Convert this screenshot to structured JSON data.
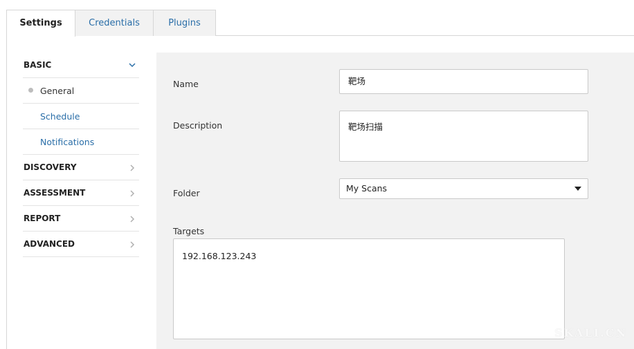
{
  "tabs": [
    {
      "label": "Settings",
      "active": true
    },
    {
      "label": "Credentials",
      "active": false
    },
    {
      "label": "Plugins",
      "active": false
    }
  ],
  "sidebar": {
    "items": [
      {
        "label": "BASIC",
        "type": "section",
        "icon": "chevron-down-icon",
        "expanded": true
      },
      {
        "label": "General",
        "type": "sub",
        "current": true
      },
      {
        "label": "Schedule",
        "type": "sub"
      },
      {
        "label": "Notifications",
        "type": "sub"
      },
      {
        "label": "DISCOVERY",
        "type": "section",
        "icon": "chevron-right-icon"
      },
      {
        "label": "ASSESSMENT",
        "type": "section",
        "icon": "chevron-right-icon"
      },
      {
        "label": "REPORT",
        "type": "section",
        "icon": "chevron-right-icon"
      },
      {
        "label": "ADVANCED",
        "type": "section",
        "icon": "chevron-right-icon"
      }
    ]
  },
  "form": {
    "name_label": "Name",
    "name_value": "靶场",
    "description_label": "Description",
    "description_value": "靶场扫描",
    "folder_label": "Folder",
    "folder_value": "My Scans",
    "targets_label": "Targets",
    "targets_value": "192.168.123.243"
  },
  "watermark": "SKALI.CN",
  "colors": {
    "link": "#2a6ea8",
    "panel_bg": "#f2f2f2",
    "border": "#c9c9c9"
  }
}
